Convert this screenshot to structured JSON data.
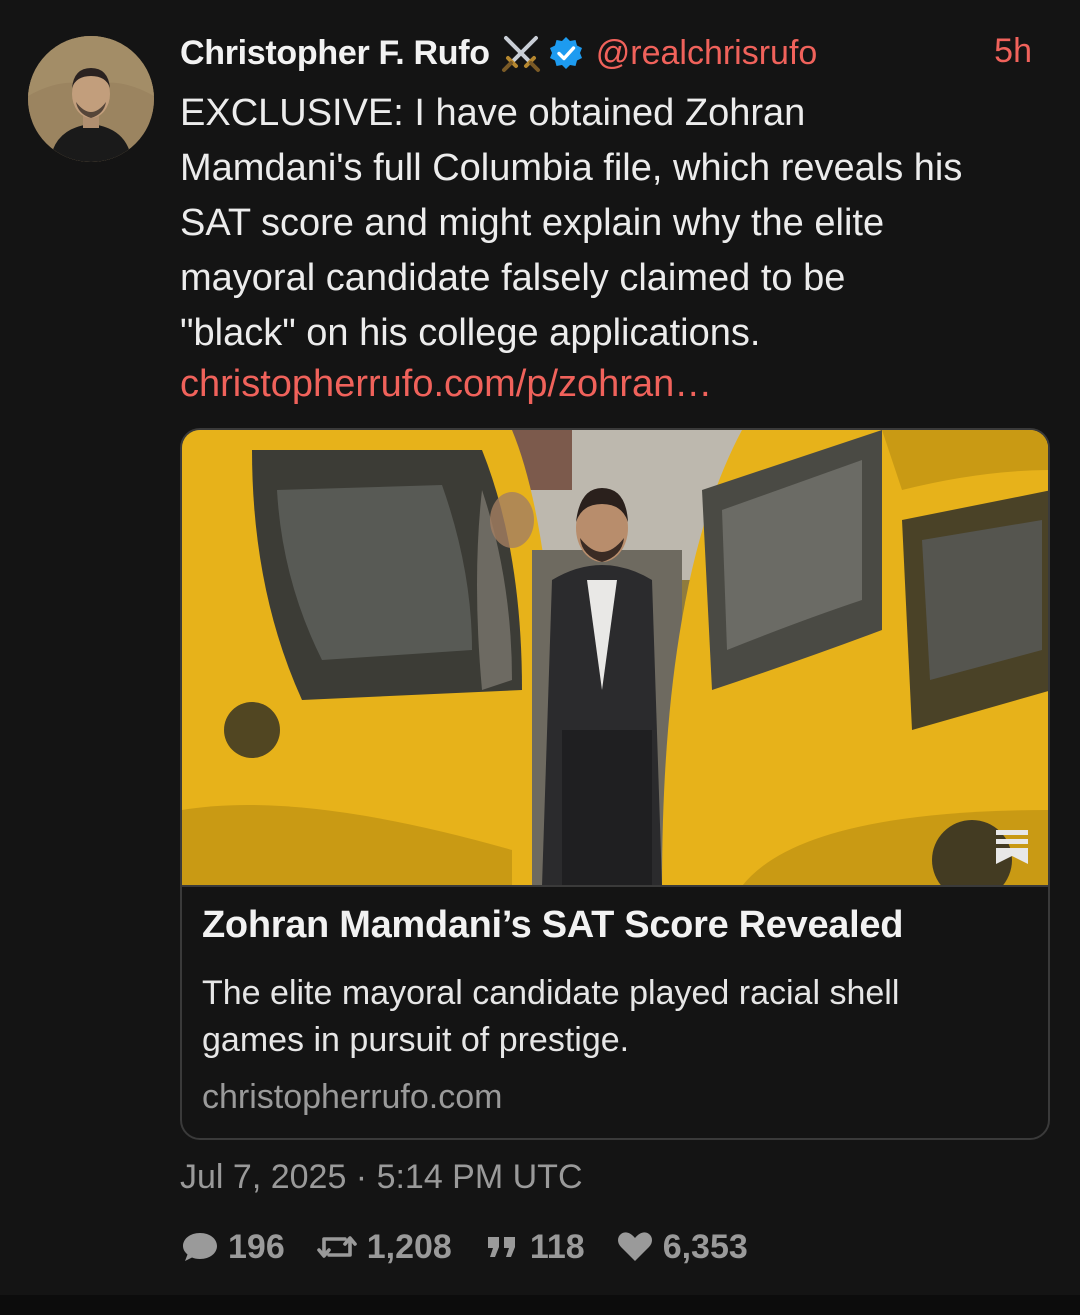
{
  "author": {
    "name": "Christopher F. Rufo",
    "handle": "@realchrisrufo",
    "time_ago": "5h"
  },
  "post": {
    "text": "EXCLUSIVE: I have obtained Zohran\nMamdani's full Columbia file, which reveals his\nSAT score and might explain why the elite\nmayoral candidate falsely claimed to be\n\"black\" on his college applications.",
    "link": "christopherrufo.com/p/zohran…"
  },
  "card": {
    "title": "Zohran Mamdani’s SAT Score Revealed",
    "description": "The elite mayoral candidate played racial shell\ngames in pursuit of prestige.",
    "domain": "christopherrufo.com"
  },
  "timestamp": "Jul 7, 2025 · 5:14 PM UTC",
  "stats": {
    "replies": "196",
    "reposts": "1,208",
    "quotes": "118",
    "likes": "6,353"
  },
  "icons": [
    "swords-icon",
    "verified-icon",
    "bookmark-icon",
    "reply-icon",
    "repost-icon",
    "quote-icon",
    "like-icon"
  ],
  "colors": {
    "background": "#141414",
    "accent": "#f0625b",
    "muted": "#9a9a9a",
    "verified": "#1d9bf0"
  }
}
